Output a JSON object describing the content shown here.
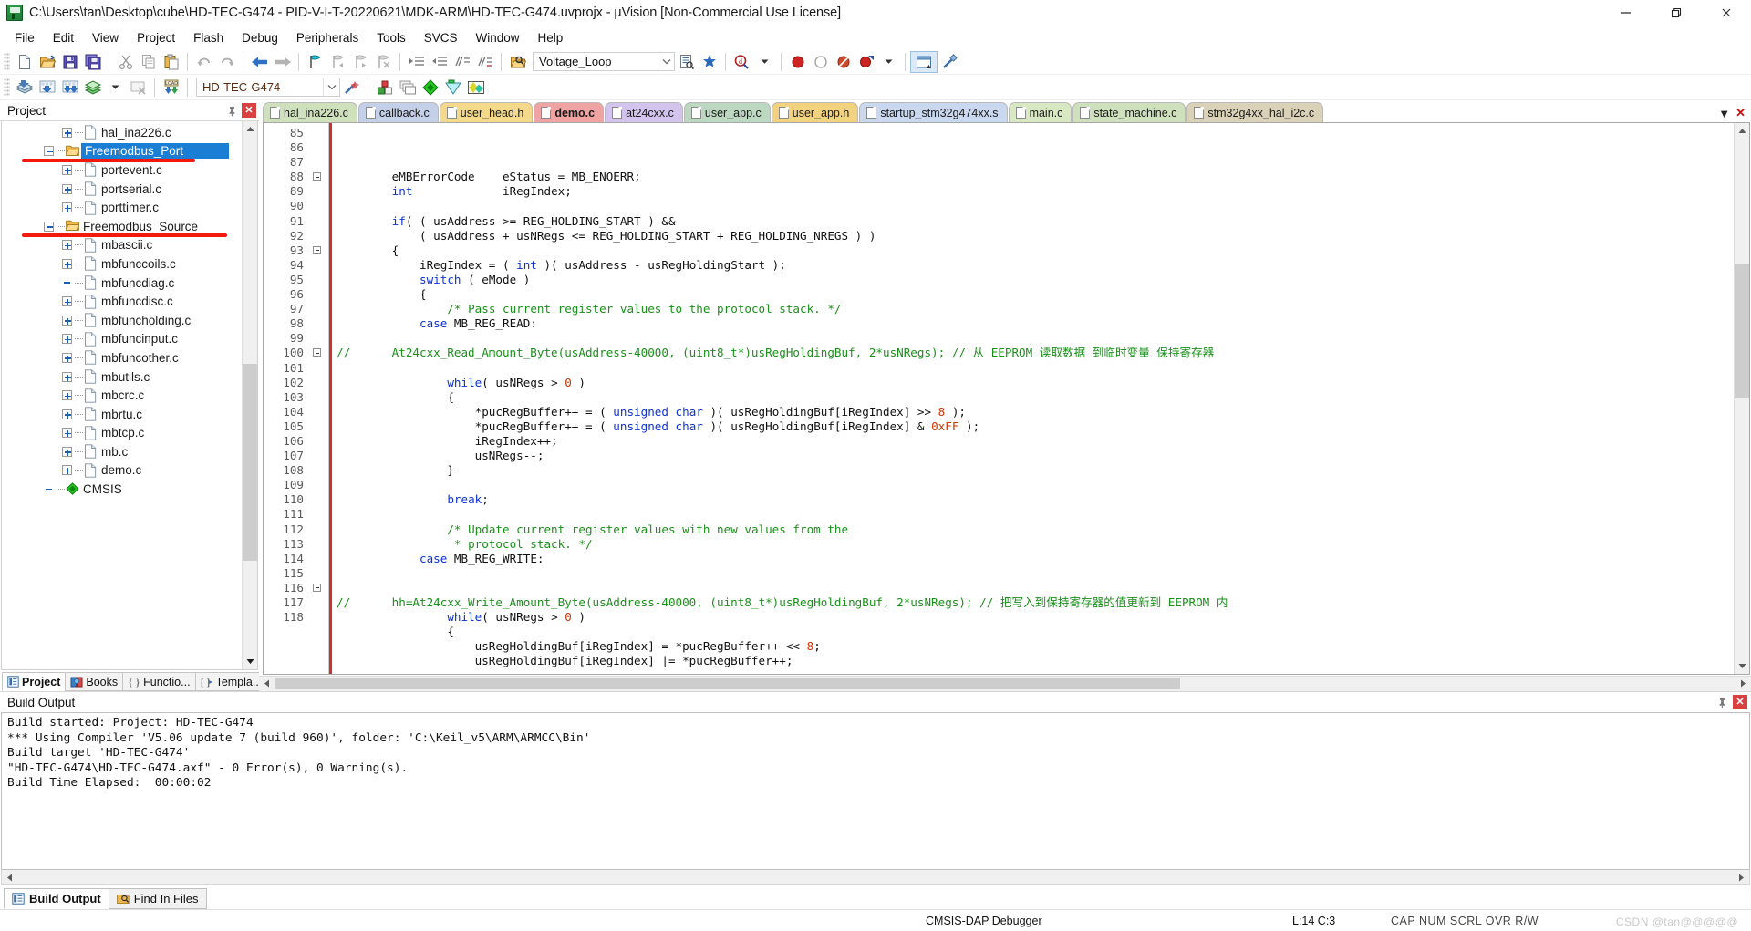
{
  "window": {
    "title": "C:\\Users\\tan\\Desktop\\cube\\HD-TEC-G474 - PID-V-I-T-20220621\\MDK-ARM\\HD-TEC-G474.uvprojx - µVision  [Non-Commercial Use License]",
    "minimize_label": "Minimize",
    "restore_label": "Restore",
    "close_label": "Close"
  },
  "menu": {
    "items": [
      "File",
      "Edit",
      "View",
      "Project",
      "Flash",
      "Debug",
      "Peripherals",
      "Tools",
      "SVCS",
      "Window",
      "Help"
    ]
  },
  "toolbar1": {
    "target_combo_value": "Voltage_Loop",
    "buttons": [
      "new-file",
      "open-file",
      "save",
      "save-all",
      "cut",
      "copy",
      "paste",
      "undo",
      "redo",
      "navigate-back",
      "navigate-forward",
      "insert-bookmark",
      "prev-bookmark",
      "next-bookmark",
      "clear-bookmarks",
      "indent",
      "outdent",
      "comment",
      "uncomment",
      "find-in-files"
    ]
  },
  "toolbar2": {
    "project_combo_value": "HD-TEC-G474",
    "buttons": [
      "build",
      "rebuild",
      "batch-build",
      "translate",
      "stop-build",
      "download",
      "target-options",
      "manage-run-environment",
      "window-arrange",
      "debug-start",
      "configuration-wizard",
      "multi-project"
    ]
  },
  "project_panel": {
    "title": "Project",
    "pin_label": "Auto Hide",
    "close_label": "Close",
    "tree": [
      {
        "label": "hal_ina226.c",
        "kind": "file",
        "depth": 2,
        "expander": "plus"
      },
      {
        "label": "Freemodbus_Port",
        "kind": "folder",
        "depth": 1,
        "expander": "minus",
        "selected": true,
        "underline": true
      },
      {
        "label": "portevent.c",
        "kind": "file",
        "depth": 2,
        "expander": "plus"
      },
      {
        "label": "portserial.c",
        "kind": "file",
        "depth": 2,
        "expander": "plus"
      },
      {
        "label": "porttimer.c",
        "kind": "file",
        "depth": 2,
        "expander": "plus"
      },
      {
        "label": "Freemodbus_Source",
        "kind": "folder",
        "depth": 1,
        "expander": "minus",
        "underline": true
      },
      {
        "label": "mbascii.c",
        "kind": "file",
        "depth": 2,
        "expander": "plus"
      },
      {
        "label": "mbfunccoils.c",
        "kind": "file",
        "depth": 2,
        "expander": "plus"
      },
      {
        "label": "mbfuncdiag.c",
        "kind": "file",
        "depth": 2,
        "expander": "none"
      },
      {
        "label": "mbfuncdisc.c",
        "kind": "file",
        "depth": 2,
        "expander": "plus"
      },
      {
        "label": "mbfuncholding.c",
        "kind": "file",
        "depth": 2,
        "expander": "plus"
      },
      {
        "label": "mbfuncinput.c",
        "kind": "file",
        "depth": 2,
        "expander": "plus"
      },
      {
        "label": "mbfuncother.c",
        "kind": "file",
        "depth": 2,
        "expander": "plus"
      },
      {
        "label": "mbutils.c",
        "kind": "file",
        "depth": 2,
        "expander": "plus"
      },
      {
        "label": "mbcrc.c",
        "kind": "file",
        "depth": 2,
        "expander": "plus"
      },
      {
        "label": "mbrtu.c",
        "kind": "file",
        "depth": 2,
        "expander": "plus"
      },
      {
        "label": "mbtcp.c",
        "kind": "file",
        "depth": 2,
        "expander": "plus"
      },
      {
        "label": "mb.c",
        "kind": "file",
        "depth": 2,
        "expander": "plus"
      },
      {
        "label": "demo.c",
        "kind": "file",
        "depth": 2,
        "expander": "plus"
      },
      {
        "label": "CMSIS",
        "kind": "cmsis",
        "depth": 1,
        "expander": "none"
      }
    ],
    "bottom_tabs": [
      {
        "label": "Project",
        "icon": "project-icon",
        "active": true
      },
      {
        "label": "Books",
        "icon": "books-icon",
        "active": false
      },
      {
        "label": "Functio...",
        "icon": "functions-icon",
        "active": false
      },
      {
        "label": "Templa...",
        "icon": "templates-icon",
        "active": false
      }
    ]
  },
  "editor": {
    "tabs": [
      {
        "label": "hal_ina226.c",
        "color": "#cfe0bd",
        "active": false
      },
      {
        "label": "callback.c",
        "color": "#c3d0e8",
        "active": false
      },
      {
        "label": "user_head.h",
        "color": "#f5d98a",
        "active": false
      },
      {
        "label": "demo.c",
        "color": "#f0a3a3",
        "active": true
      },
      {
        "label": "at24cxx.c",
        "color": "#d2c4ec",
        "active": false
      },
      {
        "label": "user_app.c",
        "color": "#bcd8c0",
        "active": false
      },
      {
        "label": "user_app.h",
        "color": "#f3d27f",
        "active": false
      },
      {
        "label": "startup_stm32g474xx.s",
        "color": "#c9d7ef",
        "active": false
      },
      {
        "label": "main.c",
        "color": "#d7e8c2",
        "active": false
      },
      {
        "label": "state_machine.c",
        "color": "#cfe0bd",
        "active": false
      },
      {
        "label": "stm32g4xx_hal_i2c.c",
        "color": "#d9d2b8",
        "active": false
      }
    ],
    "tab_menu_label": "▼",
    "tab_close_label": "✕",
    "first_line_number": 85,
    "lines": [
      {
        "n": 85,
        "fold": false,
        "html": "        eMBErrorCode    eStatus = MB_ENOERR;"
      },
      {
        "n": 86,
        "fold": false,
        "html": "        <span class=\"kw\">int</span>             iRegIndex;"
      },
      {
        "n": 87,
        "fold": false,
        "html": ""
      },
      {
        "n": 88,
        "fold": true,
        "html": "        <span class=\"kw\">if</span>( ( usAddress &gt;= REG_HOLDING_START ) &amp;&amp;"
      },
      {
        "n": 89,
        "fold": false,
        "html": "            ( usAddress + usNRegs &lt;= REG_HOLDING_START + REG_HOLDING_NREGS ) )"
      },
      {
        "n": 90,
        "fold": false,
        "html": "        {"
      },
      {
        "n": 91,
        "fold": false,
        "html": "            iRegIndex = ( <span class=\"kw\">int</span> )( usAddress - usRegHoldingStart );"
      },
      {
        "n": 92,
        "fold": false,
        "html": "            <span class=\"kw\">switch</span> ( eMode )"
      },
      {
        "n": 93,
        "fold": true,
        "html": "            {"
      },
      {
        "n": 94,
        "fold": false,
        "html": "                <span class=\"cmt\">/* Pass current register values to the protocol stack. */</span>"
      },
      {
        "n": 95,
        "fold": false,
        "html": "            <span class=\"kw\">case</span> MB_REG_READ:"
      },
      {
        "n": 96,
        "fold": false,
        "html": ""
      },
      {
        "n": 97,
        "fold": false,
        "html": "<span class=\"cmt\">//      At24cxx_Read_Amount_Byte(usAddress-40000, (uint8_t*)usRegHoldingBuf, 2*usNRegs); // 从 EEPROM 读取数据 到临时变量 保持寄存器</span>"
      },
      {
        "n": 98,
        "fold": false,
        "html": ""
      },
      {
        "n": 99,
        "fold": false,
        "html": "                <span class=\"kw\">while</span>( usNRegs &gt; <span class=\"num\">0</span> )"
      },
      {
        "n": 100,
        "fold": true,
        "html": "                {"
      },
      {
        "n": 101,
        "fold": false,
        "html": "                    *pucRegBuffer++ = ( <span class=\"kw\">unsigned char</span> )( usRegHoldingBuf[iRegIndex] &gt;&gt; <span class=\"num\">8</span> );"
      },
      {
        "n": 102,
        "fold": false,
        "html": "                    *pucRegBuffer++ = ( <span class=\"kw\">unsigned char</span> )( usRegHoldingBuf[iRegIndex] &amp; <span class=\"num\">0xFF</span> );"
      },
      {
        "n": 103,
        "fold": false,
        "html": "                    iRegIndex++;"
      },
      {
        "n": 104,
        "fold": false,
        "html": "                    usNRegs--;"
      },
      {
        "n": 105,
        "fold": false,
        "html": "                }"
      },
      {
        "n": 106,
        "fold": false,
        "html": ""
      },
      {
        "n": 107,
        "fold": false,
        "html": "                <span class=\"kw\">break</span>;"
      },
      {
        "n": 108,
        "fold": false,
        "html": ""
      },
      {
        "n": 109,
        "fold": false,
        "html": "                <span class=\"cmt\">/* Update current register values with new values from the</span>"
      },
      {
        "n": 110,
        "fold": false,
        "html": "                 <span class=\"cmt\">* protocol stack. */</span>"
      },
      {
        "n": 111,
        "fold": false,
        "html": "            <span class=\"kw\">case</span> MB_REG_WRITE:"
      },
      {
        "n": 112,
        "fold": false,
        "html": ""
      },
      {
        "n": 113,
        "fold": false,
        "html": ""
      },
      {
        "n": 114,
        "fold": false,
        "html": "<span class=\"cmt\">//      hh=At24cxx_Write_Amount_Byte(usAddress-40000, (uint8_t*)usRegHoldingBuf, 2*usNRegs); // 把写入到保持寄存器的值更新到 EEPROM 内</span>"
      },
      {
        "n": 115,
        "fold": false,
        "html": "                <span class=\"kw\">while</span>( usNRegs &gt; <span class=\"num\">0</span> )"
      },
      {
        "n": 116,
        "fold": true,
        "html": "                {"
      },
      {
        "n": 117,
        "fold": false,
        "html": "                    usRegHoldingBuf[iRegIndex] = *pucRegBuffer++ &lt;&lt; <span class=\"num\">8</span>;"
      },
      {
        "n": 118,
        "fold": false,
        "html": "                    usRegHoldingBuf[iRegIndex] |= *pucRegBuffer++;"
      }
    ]
  },
  "build_output": {
    "title": "Build Output",
    "pin_label": "Auto Hide",
    "close_label": "Close",
    "lines": [
      "Build started: Project: HD-TEC-G474",
      "*** Using Compiler 'V5.06 update 7 (build 960)', folder: 'C:\\Keil_v5\\ARM\\ARMCC\\Bin'",
      "Build target 'HD-TEC-G474'",
      "\"HD-TEC-G474\\HD-TEC-G474.axf\" - 0 Error(s), 0 Warning(s).",
      "Build Time Elapsed:  00:00:02"
    ],
    "tabs": [
      {
        "label": "Build Output",
        "icon": "build-output-icon",
        "active": true
      },
      {
        "label": "Find In Files",
        "icon": "find-in-files-icon",
        "active": false
      }
    ]
  },
  "statusbar": {
    "debugger": "CMSIS-DAP Debugger",
    "position": "L:14 C:3",
    "indicators": "CAP  NUM  SCRL  OVR  R/W"
  },
  "watermark": "CSDN @tan@@@@@"
}
